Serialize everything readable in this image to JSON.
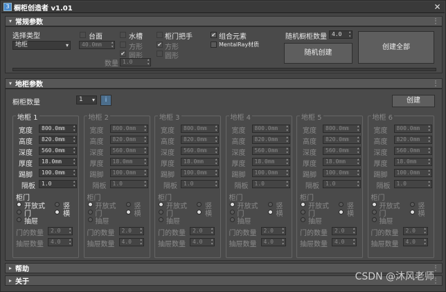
{
  "window": {
    "title": "橱柜创造者 v1.01",
    "close": "✕",
    "app_icon": "3"
  },
  "rollouts": {
    "general": {
      "label": "常规参数",
      "tri": "▾"
    },
    "cabinet": {
      "label": "地柜参数",
      "tri": "▾"
    },
    "help": {
      "label": "帮助",
      "tri": "▸"
    },
    "about": {
      "label": "关于",
      "tri": "▸"
    }
  },
  "general": {
    "select_type_label": "选择类型",
    "type_value": "地柜",
    "countertop": "台面",
    "countertop_value": "40.0mm",
    "sink": "水槽",
    "sink_square": "方形",
    "sink_round": "圆形",
    "handle": "柜门把手",
    "handle_square": "方形",
    "handle_round": "圆形",
    "count_label": "数量",
    "count_value": "1.0",
    "combo": "组合元素",
    "mentalray": "MentalRay材质",
    "random_count_label": "随机橱柜数量",
    "random_count_value": "4.0",
    "random_create": "随机创建",
    "create_all": "创建全部"
  },
  "cabinet": {
    "count_label": "橱柜数量",
    "count_value": "1",
    "info_btn": "i",
    "create_btn": "创建",
    "field_labels": {
      "width": "宽度",
      "height": "高度",
      "depth": "深度",
      "thickness": "厚度",
      "kick": "踢脚",
      "shelf": "隔板"
    },
    "door_label": "柜门",
    "open_label": "开放式",
    "door_label2": "门",
    "drawer_label": "抽屉",
    "vertical": "竖",
    "horizontal": "横",
    "door_count_label": "门的数量",
    "drawer_count_label": "抽屉数量",
    "units": [
      {
        "title": "地柜 1",
        "width": "800.0mm",
        "height": "820.0mm",
        "depth": "560.0mm",
        "thickness": "18.0mm",
        "kick": "100.0mm",
        "shelf": "1.0",
        "door_count": "2.0",
        "drawer_count": "4.0",
        "enabled": true
      },
      {
        "title": "地柜 2",
        "width": "800.0mm",
        "height": "820.0mm",
        "depth": "560.0mm",
        "thickness": "18.0mm",
        "kick": "100.0mm",
        "shelf": "1.0",
        "door_count": "2.0",
        "drawer_count": "4.0",
        "enabled": false
      },
      {
        "title": "地柜 3",
        "width": "800.0mm",
        "height": "820.0mm",
        "depth": "560.0mm",
        "thickness": "18.0mm",
        "kick": "100.0mm",
        "shelf": "1.0",
        "door_count": "2.0",
        "drawer_count": "4.0",
        "enabled": false
      },
      {
        "title": "地柜 4",
        "width": "800.0mm",
        "height": "820.0mm",
        "depth": "560.0mm",
        "thickness": "18.0mm",
        "kick": "100.0mm",
        "shelf": "1.0",
        "door_count": "2.0",
        "drawer_count": "4.0",
        "enabled": false
      },
      {
        "title": "地柜 5",
        "width": "800.0mm",
        "height": "820.0mm",
        "depth": "560.0mm",
        "thickness": "18.0mm",
        "kick": "100.0mm",
        "shelf": "1.0",
        "door_count": "2.0",
        "drawer_count": "4.0",
        "enabled": false
      },
      {
        "title": "地柜 6",
        "width": "800.0mm",
        "height": "820.0mm",
        "depth": "560.0mm",
        "thickness": "18.0mm",
        "kick": "100.0mm",
        "shelf": "1.0",
        "door_count": "2.0",
        "drawer_count": "4.0",
        "enabled": false
      }
    ]
  },
  "watermark": "CSDN @沐风老师"
}
